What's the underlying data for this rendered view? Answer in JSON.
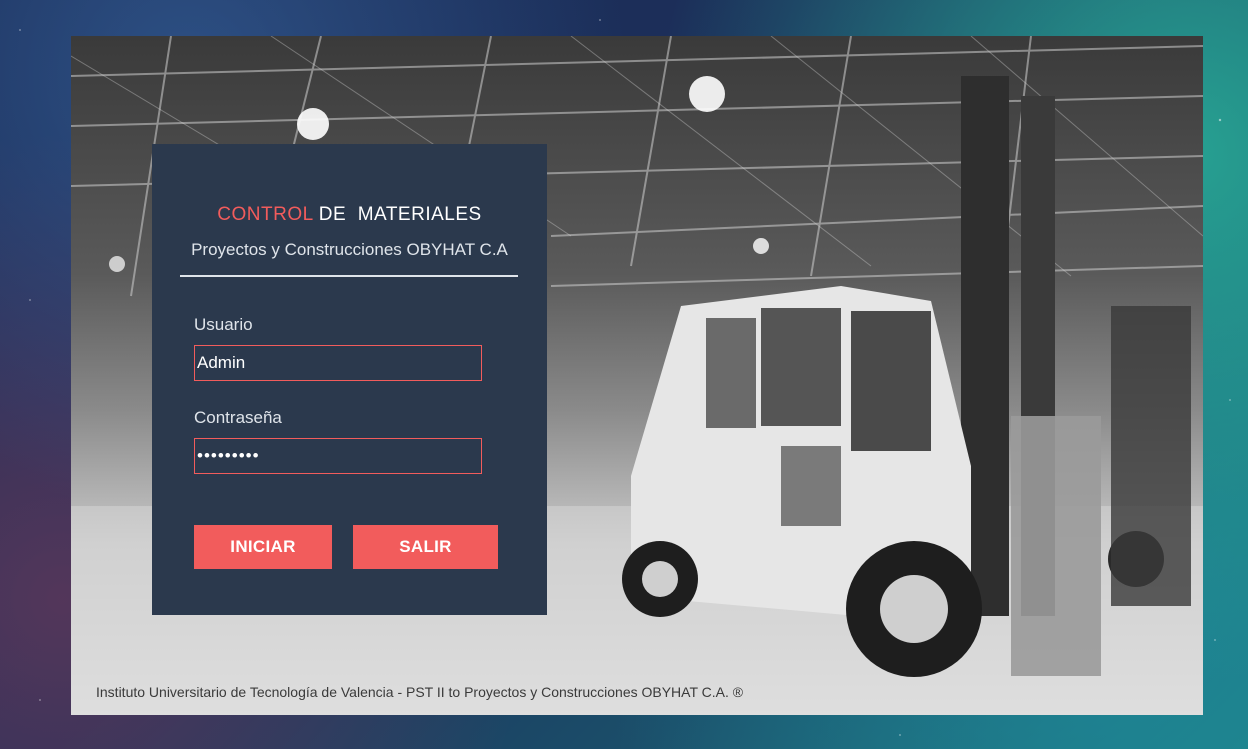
{
  "header": {
    "title_accent": "CONTROL",
    "title_rest": " DE  MATERIALES",
    "subtitle": "Proyectos y Construcciones OBYHAT C.A"
  },
  "form": {
    "username_label": "Usuario",
    "username_value": "Admin",
    "password_label": "Contraseña",
    "password_value": "•••••••••"
  },
  "buttons": {
    "login_label": "INICIAR",
    "exit_label": "SALIR"
  },
  "footer": {
    "text": "Instituto Universitario de Tecnología de Valencia - PST II  to  Proyectos y Construcciones OBYHAT C.A. ®"
  },
  "colors": {
    "panel": "#2b394d",
    "accent": "#f25c5c",
    "text_light": "#dfe4ea"
  },
  "background": {
    "image_subject": "warehouse-forklift-photo",
    "backdrop": "space-nebula"
  }
}
